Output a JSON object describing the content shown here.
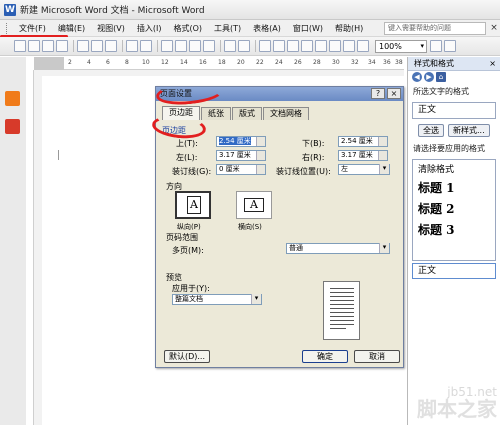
{
  "window": {
    "title": "新建 Microsoft Word 文档 - Microsoft Word"
  },
  "menubar": {
    "items": [
      "文件(F)",
      "编辑(E)",
      "视图(V)",
      "插入(I)",
      "格式(O)",
      "工具(T)",
      "表格(A)",
      "窗口(W)",
      "帮助(H)"
    ],
    "help_placeholder": "键入需要帮助的问题",
    "close": "×"
  },
  "toolbar": {
    "zoom": "100%"
  },
  "ruler": {
    "numbers": [
      "2",
      "4",
      "6",
      "8",
      "10",
      "12",
      "14",
      "16",
      "18",
      "20",
      "22",
      "24",
      "26",
      "28",
      "30",
      "32",
      "34",
      "36",
      "38"
    ]
  },
  "taskpane": {
    "title": "样式和格式",
    "selected_text_label": "所选文字的格式",
    "current_format": "正文",
    "select_all": "全选",
    "new_style": "新样式...",
    "apply_label": "请选择要应用的格式",
    "styles": [
      "清除格式",
      "标题 1",
      "标题 2",
      "标题 3"
    ],
    "normal": "正文"
  },
  "dialog": {
    "title": "页面设置",
    "help_btn": "?",
    "close_btn": "×",
    "tabs": [
      "页边距",
      "纸张",
      "版式",
      "文档网格"
    ],
    "margins_group": "页边距",
    "fields": {
      "top_label": "上(T):",
      "top_value": "2.54 厘米",
      "bottom_label": "下(B):",
      "bottom_value": "2.54 厘米",
      "left_label": "左(L):",
      "left_value": "3.17 厘米",
      "right_label": "右(R):",
      "right_value": "3.17 厘米",
      "gutter_label": "装订线(G):",
      "gutter_value": "0 厘米",
      "gutter_pos_label": "装订线位置(U):",
      "gutter_pos_value": "左"
    },
    "orientation_group": "方向",
    "portrait": "纵向(P)",
    "landscape": "横向(S)",
    "pages_group": "页码范围",
    "multiple_pages_label": "多页(M):",
    "multiple_pages_value": "普通",
    "preview_group": "预览",
    "apply_to_label": "应用于(Y):",
    "apply_to_value": "整篇文档",
    "default_btn": "默认(D)...",
    "ok_btn": "确定",
    "cancel_btn": "取消"
  },
  "watermark": {
    "site": "jb51.net",
    "name": "脚本之家"
  }
}
